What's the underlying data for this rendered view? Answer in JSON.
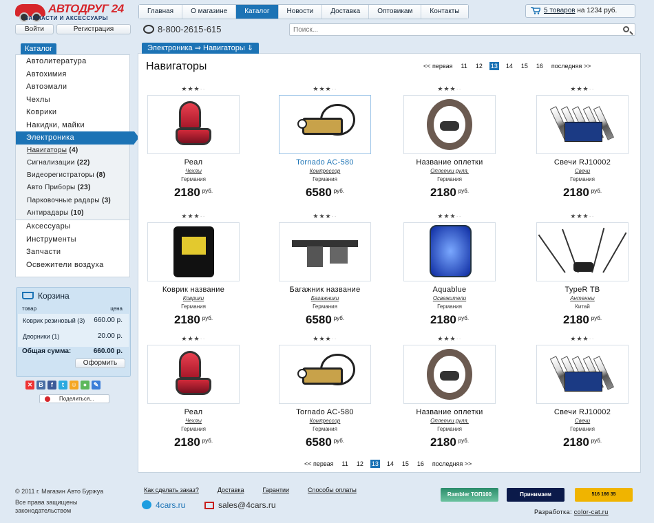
{
  "logo": {
    "brand": "АВТОДРУГ 24",
    "tagline": "ЗАПЧАСТИ И АКСЕССУАРЫ"
  },
  "nav": [
    "Главная",
    "О магазине",
    "Каталог",
    "Новости",
    "Доставка",
    "Оптовикам",
    "Контакты"
  ],
  "nav_active": 2,
  "cart_top": {
    "link": "5 товаров",
    "rest": "на 1234 руб."
  },
  "auth": {
    "login": "Войти",
    "register": "Регистрация"
  },
  "phone": "8-800-2615-615",
  "search": {
    "placeholder": "Поиск..."
  },
  "catalog_tab": "Каталог",
  "categories": {
    "top": [
      "Автолитература",
      "Автохимия",
      "Автоэмали",
      "Чехлы",
      "Коврики",
      "Накидки, майки"
    ],
    "active": "Электроника",
    "sub": [
      {
        "name": "Навигаторы",
        "count": "(4)"
      },
      {
        "name": "Сигнализации",
        "count": "(22)"
      },
      {
        "name": "Видеорегистраторы",
        "count": "(8)"
      },
      {
        "name": "Авто Приборы",
        "count": "(23)"
      },
      {
        "name": "Парковочные радары",
        "count": "(3)"
      },
      {
        "name": "Антирадары",
        "count": "(10)"
      }
    ],
    "bottom": [
      "Аксессуары",
      "Инструменты",
      "Запчасти",
      "Освежители воздуха"
    ]
  },
  "basket": {
    "title": "Корзина",
    "col_item": "товар",
    "col_price": "цена",
    "rows": [
      {
        "name": "Коврик резиновый (3)",
        "price": "660.00 р."
      },
      {
        "name": "Дворники (1)",
        "price": "20.00 р."
      }
    ],
    "total_label": "Общая сумма:",
    "total": "660.00 р.",
    "order": "Оформить"
  },
  "share": "Поделиться...",
  "breadcrumb": "Электроника ⇒ Навигаторы ⇓",
  "title": "Навигаторы",
  "pager": {
    "prev": "<< первая",
    "pages": [
      "11",
      "12",
      "13",
      "14",
      "15",
      "16"
    ],
    "current": "13",
    "next": "последняя >>"
  },
  "currency": "руб.",
  "products": [
    {
      "name": "Реал",
      "cat": "Чехлы",
      "country": "Германия",
      "price": "2180",
      "rating": 3,
      "img": "seat"
    },
    {
      "name": "Tornado AC-580",
      "cat": "Компрессор",
      "country": "Германия",
      "price": "6580",
      "rating": 3,
      "img": "compressor",
      "highlight": true
    },
    {
      "name": "Название оплетки",
      "cat": "Оплетки руля.",
      "country": "Германия",
      "price": "2180",
      "rating": 3,
      "img": "wheel"
    },
    {
      "name": "Свечи RJ10002",
      "cat": "Свечи",
      "country": "Германия",
      "price": "2180",
      "rating": 3,
      "img": "plugs"
    },
    {
      "name": "Коврик название",
      "cat": "Коврики",
      "country": "Германия",
      "price": "2180",
      "rating": 3,
      "img": "mat"
    },
    {
      "name": "Багажник название",
      "cat": "Багажники",
      "country": "Германия",
      "price": "6580",
      "rating": 3,
      "img": "rack"
    },
    {
      "name": "Aquablue",
      "cat": "Освежители",
      "country": "Германия",
      "price": "2180",
      "rating": 3,
      "img": "aqua"
    },
    {
      "name": "TypeR TB",
      "cat": "Антенны",
      "country": "Китай",
      "price": "2180",
      "rating": 3,
      "img": "antenna"
    },
    {
      "name": "Реал",
      "cat": "Чехлы",
      "country": "Германия",
      "price": "2180",
      "rating": 3,
      "img": "seat"
    },
    {
      "name": "Tornado AC-580",
      "cat": "Компрессор",
      "country": "Германия",
      "price": "6580",
      "rating": 3,
      "img": "compressor"
    },
    {
      "name": "Название оплетки",
      "cat": "Оплетки руля.",
      "country": "Германия",
      "price": "2180",
      "rating": 3,
      "img": "wheel"
    },
    {
      "name": "Свечи RJ10002",
      "cat": "Свечи",
      "country": "Германия",
      "price": "2180",
      "rating": 3,
      "img": "plugs"
    }
  ],
  "footer": {
    "copy": [
      "© 2011 г. Магазин Авто Буржуа",
      "Все права защищены",
      "законодательством"
    ],
    "links": [
      "Как сделать заказ?",
      "Доставка",
      "Гарантии",
      "Сnособы оплаты"
    ],
    "skype": "4cars.ru",
    "email": "sales@4cars.ru",
    "badges": [
      "Rambler ТОП100",
      "Принимаем",
      "516 166 35"
    ],
    "dev_label": "Разработка:",
    "dev_link": "color-cat.ru"
  },
  "colors": {
    "accent": "#1c73b5",
    "brand": "#d6262b",
    "bg": "#dfe9f3"
  }
}
